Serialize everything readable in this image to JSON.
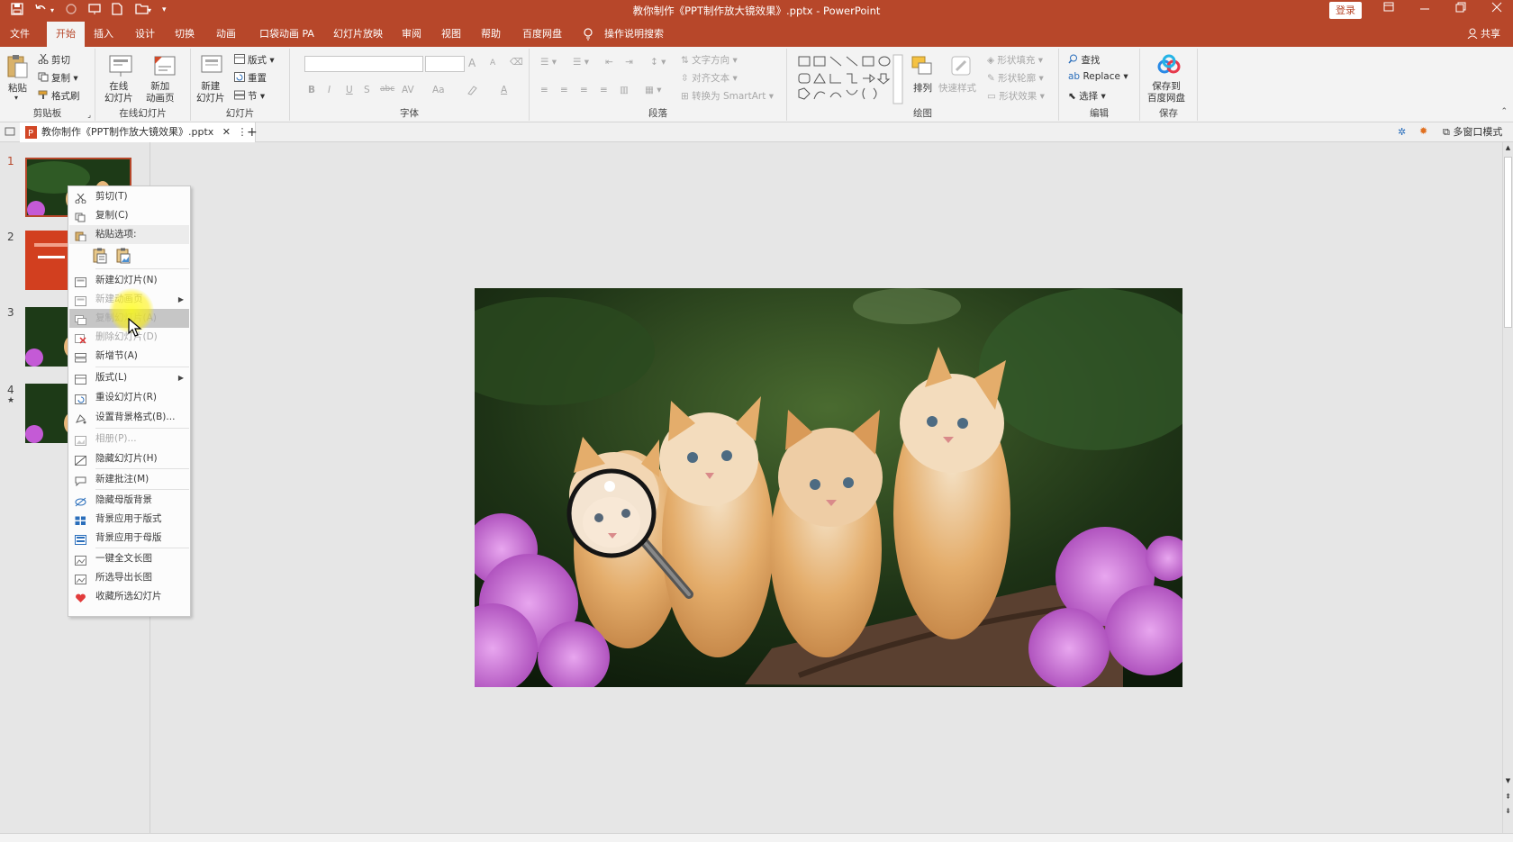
{
  "titlebar": {
    "title": "教你制作《PPT制作放大镜效果》.pptx  -  PowerPoint",
    "login": "登录"
  },
  "tabs": [
    {
      "label": "文件"
    },
    {
      "label": "开始"
    },
    {
      "label": "插入"
    },
    {
      "label": "设计"
    },
    {
      "label": "切换"
    },
    {
      "label": "动画"
    },
    {
      "label": "口袋动画 PA"
    },
    {
      "label": "幻灯片放映"
    },
    {
      "label": "审阅"
    },
    {
      "label": "视图"
    },
    {
      "label": "帮助"
    },
    {
      "label": "百度网盘"
    },
    {
      "label": "操作说明搜索"
    }
  ],
  "share": "共享",
  "ribbon": {
    "clipboard": {
      "paste": "粘贴",
      "cut": "剪切",
      "copy": "复制",
      "format_painter": "格式刷",
      "label": "剪贴板"
    },
    "online": {
      "online_slides": "在线\n幻灯片",
      "new_anim": "新加\n动画页",
      "label": "在线幻灯片"
    },
    "slides": {
      "new_slide": "新建\n幻灯片",
      "layout": "版式",
      "reset": "重置",
      "section": "节",
      "label": "幻灯片"
    },
    "font": {
      "bold": "B",
      "italic": "I",
      "underline": "U",
      "shadow": "S",
      "strike": "abc",
      "spacing": "AV",
      "case": "Aa",
      "grow": "A",
      "shrink": "A",
      "color": "A",
      "label": "字体"
    },
    "paragraph": {
      "text_dir": "文字方向",
      "align_text": "对齐文本",
      "smartart": "转换为 SmartArt",
      "label": "段落"
    },
    "drawing": {
      "arrange": "排列",
      "quick_styles": "快速样式",
      "fill": "形状填充",
      "outline": "形状轮廓",
      "effects": "形状效果",
      "label": "绘图"
    },
    "editing": {
      "find": "查找",
      "replace": "Replace",
      "select": "选择",
      "label": "编辑"
    },
    "save": {
      "baidu": "保存到\n百度网盘",
      "label": "保存"
    }
  },
  "docbar": {
    "doc_tab": "教你制作《PPT制作放大镜效果》.pptx",
    "add": "+",
    "multiwindow": "多窗口模式"
  },
  "thumbnails": [
    {
      "num": "1"
    },
    {
      "num": "2"
    },
    {
      "num": "3"
    },
    {
      "num": "4",
      "star": "★"
    }
  ],
  "context_menu": {
    "items": [
      {
        "label": "剪切(T)",
        "icon": "scissors-icon"
      },
      {
        "label": "复制(C)",
        "icon": "copy-icon"
      },
      {
        "label": "粘贴选项:",
        "icon": "paste-icon"
      },
      {
        "label": "新建幻灯片(N)",
        "icon": "new-slide-icon"
      },
      {
        "label": "新建动画页",
        "icon": "new-anim-icon"
      },
      {
        "label": "复制幻灯片(A)",
        "icon": "duplicate-icon"
      },
      {
        "label": "删除幻灯片(D)",
        "icon": "delete-icon"
      },
      {
        "label": "新增节(A)",
        "icon": "section-icon"
      },
      {
        "label": "版式(L)",
        "icon": "layout-icon"
      },
      {
        "label": "重设幻灯片(R)",
        "icon": "reset-icon"
      },
      {
        "label": "设置背景格式(B)...",
        "icon": "background-icon"
      },
      {
        "label": "相册(P)...",
        "icon": "album-icon"
      },
      {
        "label": "隐藏幻灯片(H)",
        "icon": "hide-icon"
      },
      {
        "label": "新建批注(M)",
        "icon": "comment-icon"
      },
      {
        "label": "隐藏母版背景",
        "icon": "hide-master-icon"
      },
      {
        "label": "背景应用于版式",
        "icon": "apply-layout-icon"
      },
      {
        "label": "背景应用于母版",
        "icon": "apply-master-icon"
      },
      {
        "label": "一键全文长图",
        "icon": "long-image-icon"
      },
      {
        "label": "所选导出长图",
        "icon": "export-image-icon"
      },
      {
        "label": "收藏所选幻灯片",
        "icon": "favorite-icon"
      }
    ]
  },
  "colors": {
    "accent": "#b7472a",
    "ribbon_bg": "#f3f3f3",
    "workspace": "#e6e6e6"
  }
}
